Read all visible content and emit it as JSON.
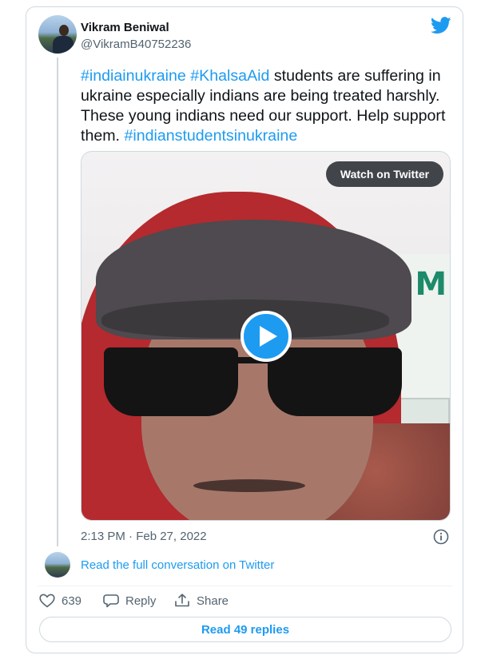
{
  "author": {
    "name": "Vikram Beniwal",
    "handle": "@VikramB40752236"
  },
  "tweet": {
    "segments": [
      {
        "text": "#indiainukraine",
        "tag": true
      },
      {
        "text": " ",
        "tag": false
      },
      {
        "text": "#KhalsaAid",
        "tag": true
      },
      {
        "text": " students are suffering in ukraine especially indians are being treated harshly. These young indians need our support. Help support them. ",
        "tag": false
      },
      {
        "text": "#indianstudentsinukraine",
        "tag": true
      }
    ]
  },
  "media": {
    "watch_label": "Watch on Twitter",
    "sign_text": "HIM"
  },
  "timestamp": "2:13 PM · Feb 27, 2022",
  "read_conversation": "Read the full conversation on Twitter",
  "actions": {
    "like_count": "639",
    "reply_label": "Reply",
    "share_label": "Share"
  },
  "read_replies": "Read 49 replies",
  "colors": {
    "accent": "#1d9bf0",
    "text": "#0f1419",
    "secondary": "#536471",
    "border": "#cfd9de"
  },
  "icons": {
    "brand": "twitter-bird-icon",
    "play": "play-icon",
    "info": "info-icon",
    "like": "heart-icon",
    "reply": "reply-bubble-icon",
    "share": "share-icon"
  }
}
